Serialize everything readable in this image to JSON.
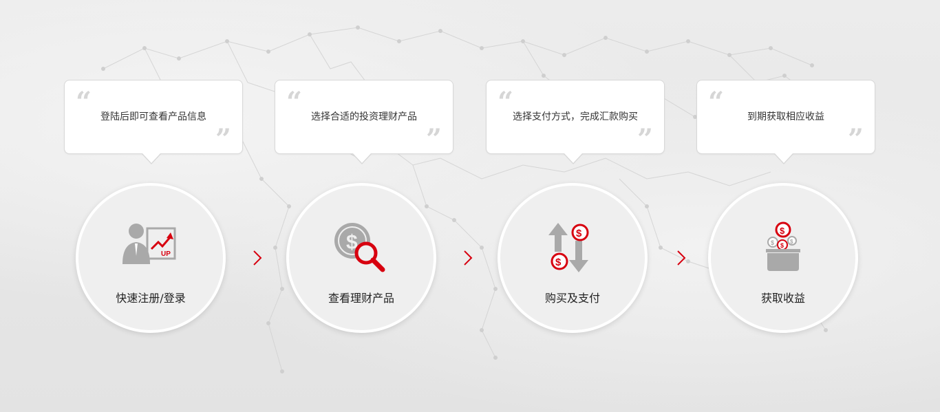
{
  "steps": [
    {
      "bubble_text": "登陆后即可查看产品信息",
      "label": "快速注册/登录",
      "icon": "user-up-icon"
    },
    {
      "bubble_text": "选择合适的投资理财产品",
      "label": "查看理财产品",
      "icon": "money-search-icon"
    },
    {
      "bubble_text": "选择支付方式，完成汇款购买",
      "label": "购买及支付",
      "icon": "exchange-arrows-icon"
    },
    {
      "bubble_text": "到期获取相应收益",
      "label": "获取收益",
      "icon": "coins-box-icon"
    }
  ],
  "quote_open": "“",
  "quote_close": "”",
  "icon_badge": "UP",
  "colors": {
    "accent": "#d7000f",
    "icon_gray": "#a9a9a9",
    "text": "#222222"
  }
}
